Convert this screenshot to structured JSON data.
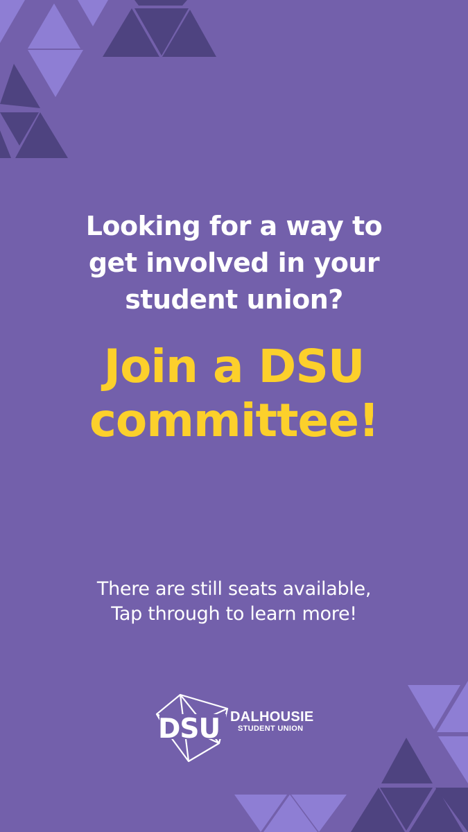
{
  "colors": {
    "background": "#7360ab",
    "headline": "#fcd02b",
    "text": "#ffffff",
    "triangle_dark": "#4e4380",
    "triangle_light": "#8e7ed4"
  },
  "intro": {
    "line1": "Looking for a way to",
    "line2": "get involved in your",
    "line3": "student union?"
  },
  "headline": {
    "line1": "Join a DSU",
    "line2": "committee!"
  },
  "subtext": {
    "line1": "There are still seats available,",
    "line2": "Tap through to learn more!"
  },
  "logo": {
    "mark": "DSU",
    "name": "DALHOUSIE",
    "tagline": "STUDENT UNION"
  }
}
